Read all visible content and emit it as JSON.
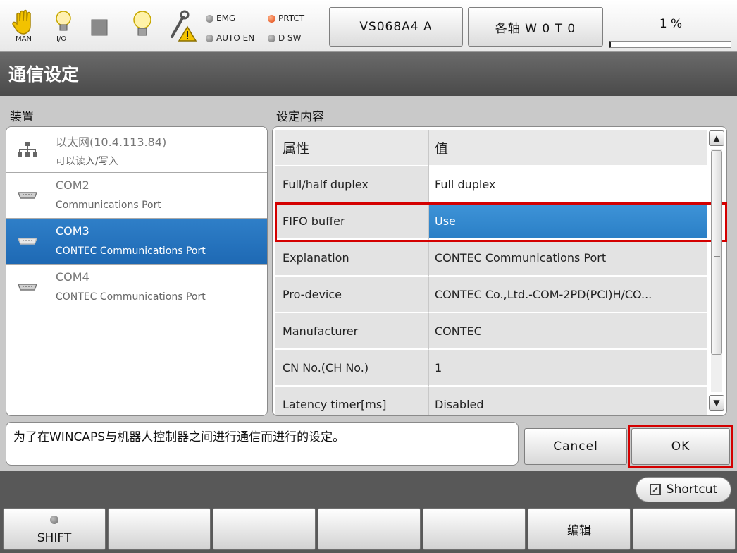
{
  "topbar": {
    "man_label": "MAN",
    "io_label": "I/O",
    "leds": {
      "emg": "EMG",
      "prtct": "PRTCT",
      "auto_en": "AUTO EN",
      "d_sw": "D SW"
    },
    "robot_button": "VS068A4 A",
    "axes_button": "各轴  W 0 T 0",
    "speed_percent": "1 %",
    "speed_fraction": 0.01
  },
  "title": "通信设定",
  "device_panel": {
    "label": "装置",
    "items": [
      {
        "title": "以太网(10.4.113.84)",
        "subtitle": "可以读入/写入",
        "icon": "network-icon",
        "selected": false
      },
      {
        "title": "COM2",
        "subtitle": "Communications Port",
        "icon": "serial-port-icon",
        "selected": false
      },
      {
        "title": "COM3",
        "subtitle": "CONTEC Communications Port",
        "icon": "serial-port-icon",
        "selected": true
      },
      {
        "title": "COM4",
        "subtitle": "CONTEC Communications Port",
        "icon": "serial-port-icon",
        "selected": false
      }
    ]
  },
  "settings_panel": {
    "label": "设定内容",
    "header": {
      "property": "属性",
      "value": "值"
    },
    "rows": [
      {
        "property": "Full/half duplex",
        "value": "Full duplex"
      },
      {
        "property": "FIFO buffer",
        "value": "Use"
      },
      {
        "property": "Explanation",
        "value": "CONTEC Communications Port"
      },
      {
        "property": "Pro-device",
        "value": "CONTEC Co.,Ltd.-COM-2PD(PCI)H/CO..."
      },
      {
        "property": "Manufacturer",
        "value": "CONTEC"
      },
      {
        "property": "CN No.(CH No.)",
        "value": "1"
      },
      {
        "property": "Latency timer[ms]",
        "value": "Disabled"
      }
    ],
    "scroll_up": "▲",
    "scroll_down": "▼"
  },
  "description": "为了在WINCAPS与机器人控制器之间进行通信而进行的设定。",
  "buttons": {
    "cancel": "Cancel",
    "ok": "OK",
    "shortcut": "Shortcut"
  },
  "function_keys": [
    "SHIFT",
    "",
    "",
    "",
    "",
    "编辑",
    ""
  ],
  "colors": {
    "selection_blue": "#1e69b4",
    "highlight_red": "#d40000",
    "title_bar": "#555555"
  }
}
